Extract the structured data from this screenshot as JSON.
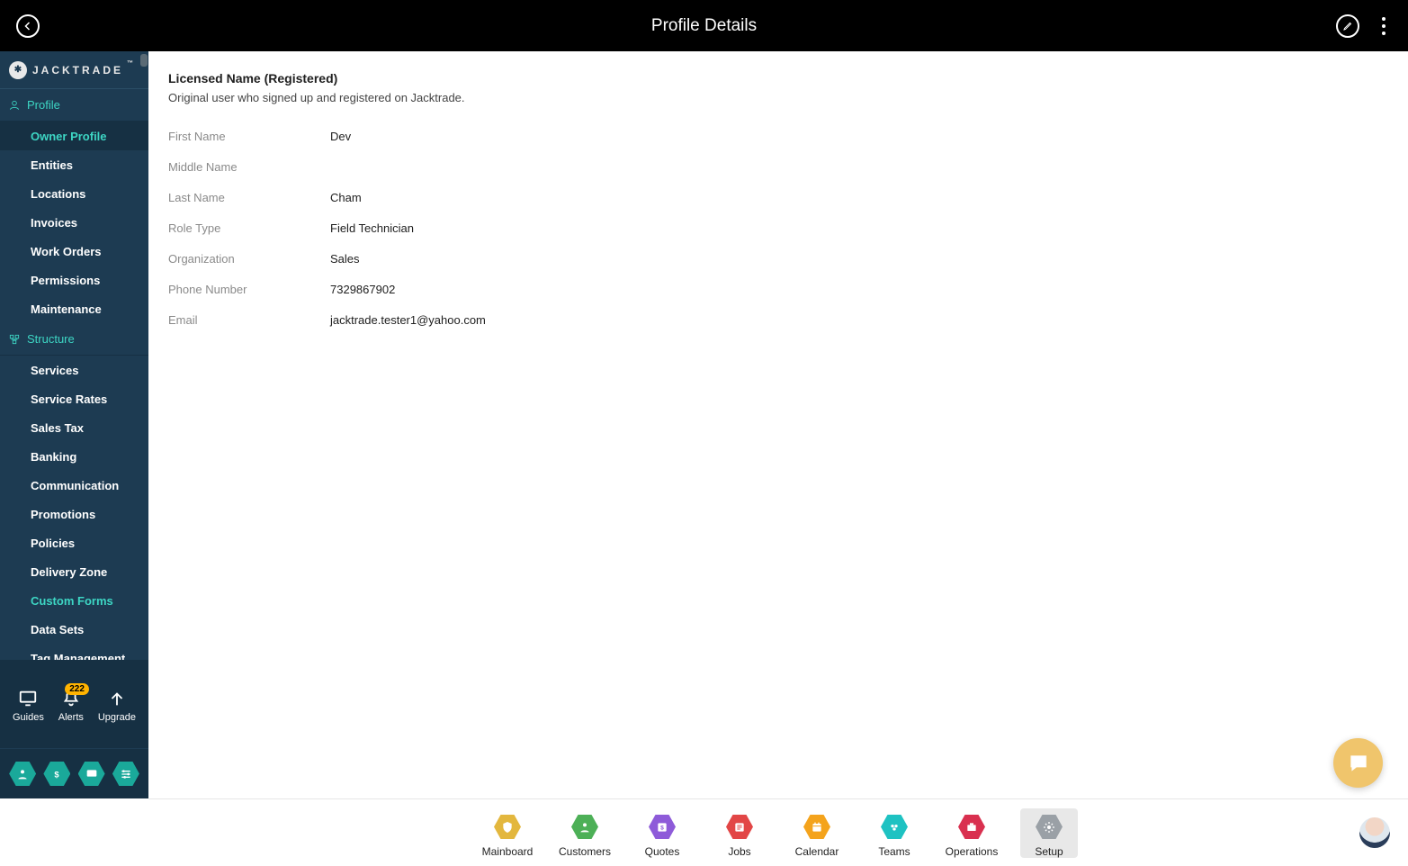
{
  "topbar": {
    "title": "Profile Details"
  },
  "brand": {
    "name": "JACKTRADE",
    "initial": "✱",
    "tm": "™"
  },
  "sidebar": {
    "sections": [
      {
        "label": "Profile",
        "icon": "user-icon",
        "items": [
          {
            "label": "Owner Profile",
            "active": true
          },
          {
            "label": "Entities"
          },
          {
            "label": "Locations"
          },
          {
            "label": "Invoices"
          },
          {
            "label": "Work Orders"
          },
          {
            "label": "Permissions"
          },
          {
            "label": "Maintenance"
          }
        ]
      },
      {
        "label": "Structure",
        "icon": "structure-icon",
        "items": [
          {
            "label": "Services"
          },
          {
            "label": "Service Rates"
          },
          {
            "label": "Sales Tax"
          },
          {
            "label": "Banking"
          },
          {
            "label": "Communication"
          },
          {
            "label": "Promotions"
          },
          {
            "label": "Policies"
          },
          {
            "label": "Delivery Zone"
          },
          {
            "label": "Custom Forms",
            "highlight": true
          },
          {
            "label": "Data Sets"
          },
          {
            "label": "Tag Management"
          }
        ]
      }
    ]
  },
  "quickActions": {
    "guides": "Guides",
    "alerts": "Alerts",
    "alertsCount": "222",
    "upgrade": "Upgrade"
  },
  "main": {
    "sectionTitle": "Licensed Name (Registered)",
    "sectionSub": "Original user who signed up and registered on Jacktrade.",
    "fields": [
      {
        "label": "First Name",
        "value": "Dev"
      },
      {
        "label": "Middle Name",
        "value": ""
      },
      {
        "label": "Last Name",
        "value": "Cham"
      },
      {
        "label": "Role Type",
        "value": "Field Technician"
      },
      {
        "label": "Organization",
        "value": "Sales"
      },
      {
        "label": "Phone Number",
        "value": "7329867902"
      },
      {
        "label": "Email",
        "value": "jacktrade.tester1@yahoo.com"
      }
    ]
  },
  "bottomnav": [
    {
      "label": "Mainboard",
      "color": "#e3b73e",
      "icon": "shield"
    },
    {
      "label": "Customers",
      "color": "#4db057",
      "icon": "person"
    },
    {
      "label": "Quotes",
      "color": "#8e5bd9",
      "icon": "quote"
    },
    {
      "label": "Jobs",
      "color": "#e24646",
      "icon": "list"
    },
    {
      "label": "Calendar",
      "color": "#f4a31c",
      "icon": "calendar"
    },
    {
      "label": "Teams",
      "color": "#1ec2c2",
      "icon": "team"
    },
    {
      "label": "Operations",
      "color": "#d9304f",
      "icon": "briefcase"
    },
    {
      "label": "Setup",
      "color": "#9aa0a6",
      "icon": "gear",
      "active": true
    }
  ]
}
